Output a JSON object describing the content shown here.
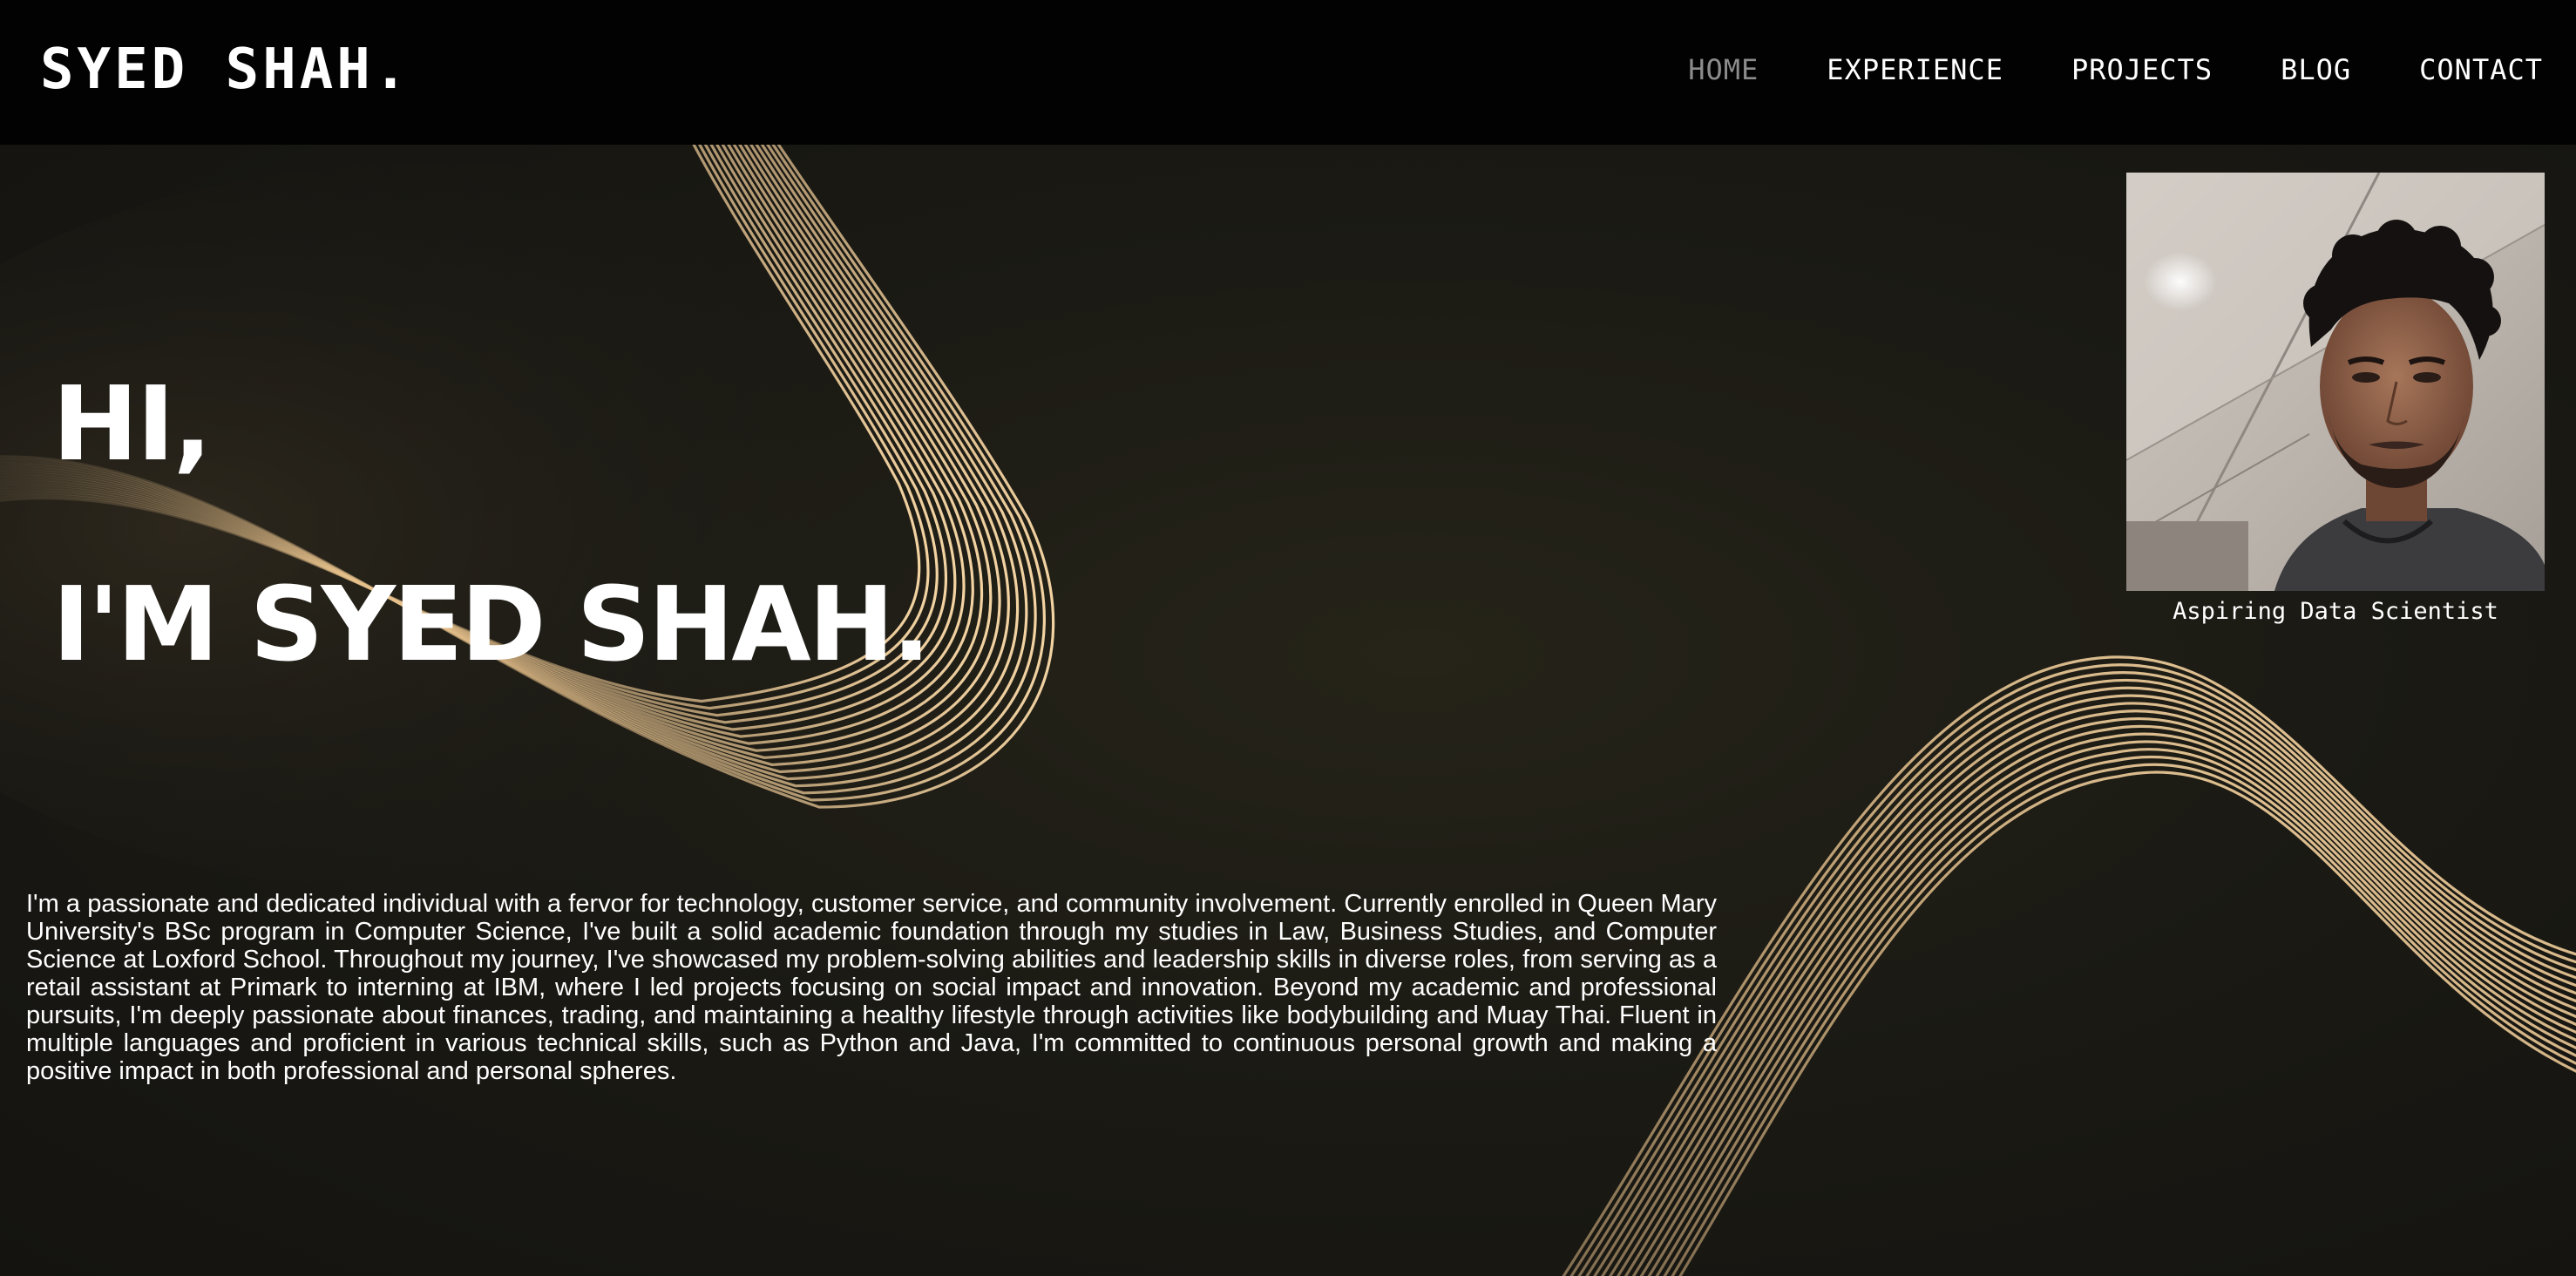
{
  "header": {
    "brand": "SYED SHAH.",
    "nav": [
      {
        "label": "HOME",
        "active": true
      },
      {
        "label": "EXPERIENCE",
        "active": false
      },
      {
        "label": "PROJECTS",
        "active": false
      },
      {
        "label": "BLOG",
        "active": false
      },
      {
        "label": "CONTACT",
        "active": false
      }
    ]
  },
  "hero": {
    "greeting": "HI,",
    "name_heading": "I'M SYED SHAH.",
    "bio": "I'm a passionate and dedicated individual with a fervor for technology, customer service, and community involvement. Currently enrolled in Queen Mary University's BSc program in Computer Science, I've built a solid academic foundation through my studies in Law, Business Studies, and Computer Science at Loxford School. Throughout my journey, I've showcased my problem-solving abilities and leadership skills in diverse roles, from serving as a retail assistant at Primark to interning at IBM, where I led projects focusing on social impact and innovation. Beyond my academic and professional pursuits, I'm deeply passionate about finances, trading, and maintaining a healthy lifestyle through activities like bodybuilding and Muay Thai. Fluent in multiple languages and proficient in various technical skills, such as Python and Java, I'm committed to continuous personal growth and making a positive impact in both professional and personal spheres."
  },
  "profile": {
    "caption": "Aspiring Data Scientist"
  },
  "colors": {
    "nav_background": "#020202",
    "page_background": "#1b1a14",
    "wave_gold": "#e8c28c",
    "nav_active": "#8c8c8c",
    "text": "#ffffff"
  }
}
